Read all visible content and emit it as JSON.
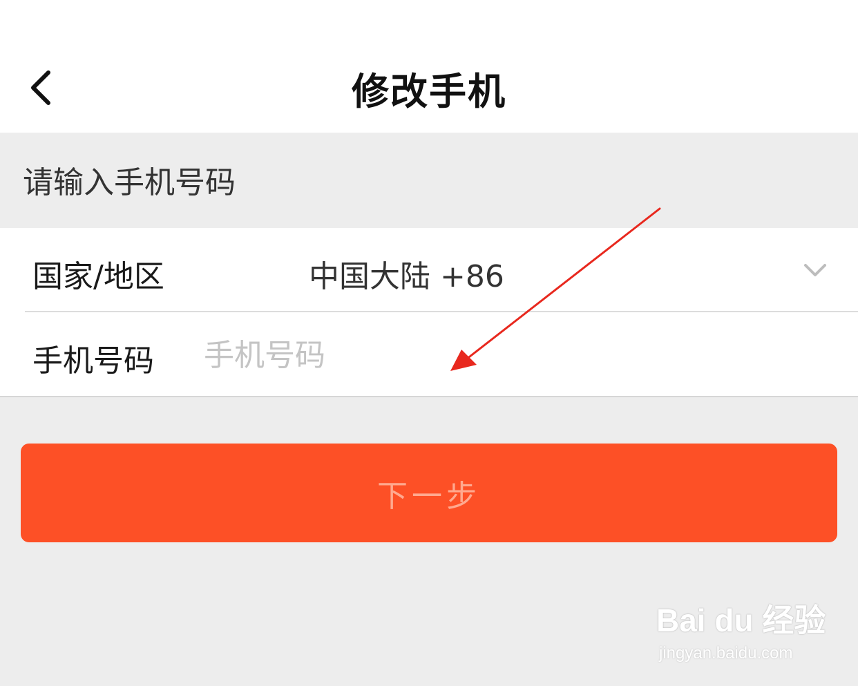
{
  "header": {
    "title": "修改手机",
    "back_icon": "chevron-left-icon"
  },
  "section_hint": "请输入手机号码",
  "form": {
    "region": {
      "label": "国家/地区",
      "value": "中国大陆 +86",
      "icon": "chevron-down-icon"
    },
    "phone": {
      "label": "手机号码",
      "value": "",
      "placeholder": "手机号码"
    }
  },
  "next_button": {
    "label": "下一步"
  },
  "annotation": {
    "color": "#e8281e"
  },
  "watermark": {
    "logo": "Bai du 经验",
    "url": "jingyan.baidu.com"
  },
  "colors": {
    "accent": "#fd5026",
    "background": "#ededed",
    "button_text": "#ffa98f"
  }
}
